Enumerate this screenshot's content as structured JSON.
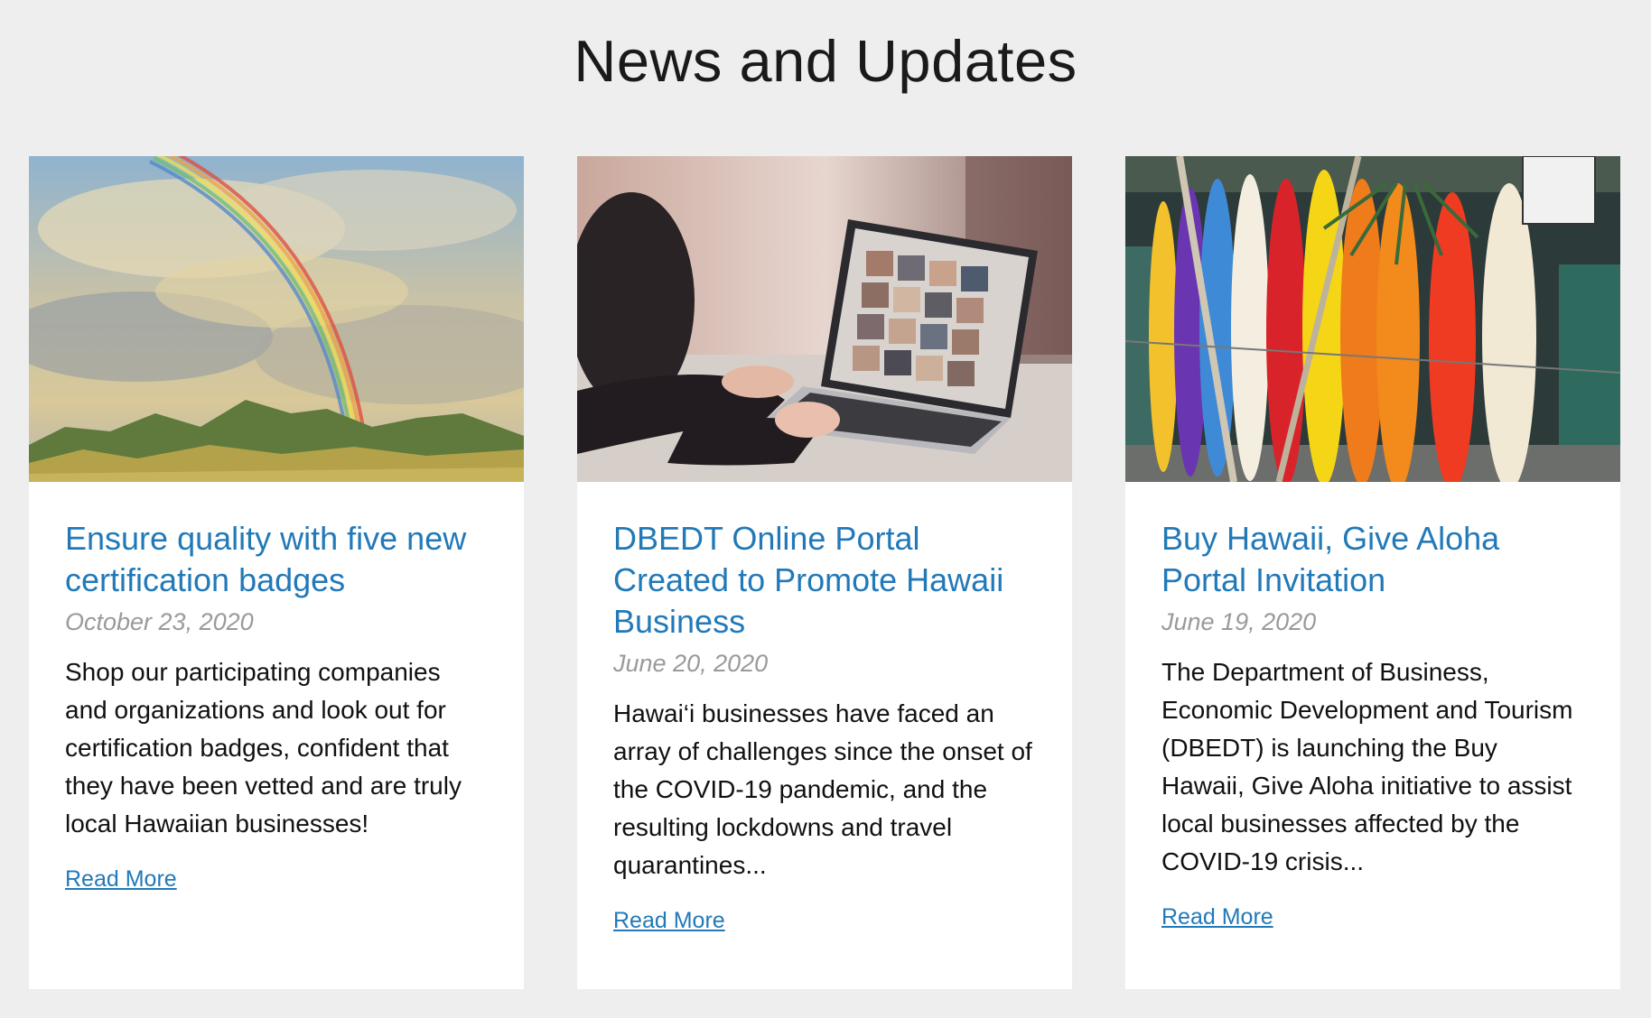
{
  "section": {
    "title": "News and Updates"
  },
  "cards": [
    {
      "image_name": "rainbow-over-mountains",
      "title": "Ensure quality with five new certification badges",
      "date": "October 23, 2020",
      "excerpt": "Shop our participating companies and organizations and look out for certification badges, confident that they have been vetted and are truly local Hawaiian businesses!",
      "read_more": "Read More"
    },
    {
      "image_name": "laptop-on-desk",
      "title": "DBEDT Online Portal Created to Promote Hawaii Business",
      "date": "June 20, 2020",
      "excerpt": "Hawai‘i businesses have faced an array of challenges since the onset of the COVID-19 pandemic, and the resulting lockdowns and travel quarantines...",
      "read_more": "Read More"
    },
    {
      "image_name": "colorful-surfboards",
      "title": "Buy Hawaii, Give Aloha Portal Invitation",
      "date": "June 19, 2020",
      "excerpt": "The Department of Business, Economic Development and Tourism (DBEDT) is launching the Buy Hawaii, Give Aloha initiative to assist local businesses affected by the COVID-19 crisis...",
      "read_more": "Read More"
    }
  ],
  "colors": {
    "background": "#eeeeee",
    "card": "#ffffff",
    "link": "#2279b8",
    "date": "#9a9a9a",
    "text": "#111111"
  }
}
